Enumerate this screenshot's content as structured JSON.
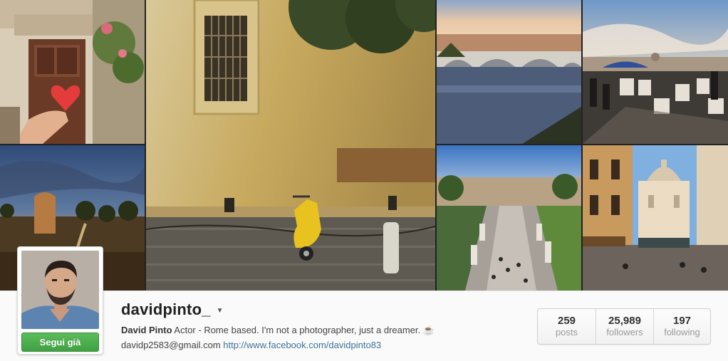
{
  "profile": {
    "username": "davidpinto_",
    "full_name": "David Pinto",
    "bio": "Actor - Rome based. I'm not a photographer, just a dreamer. ☕",
    "email": "davidp2583@gmail.com",
    "website": "http://www.facebook.com/davidpinto83",
    "follow_button_label": "Segui già"
  },
  "stats": [
    {
      "value": "259",
      "label": "posts"
    },
    {
      "value": "25,989",
      "label": "followers"
    },
    {
      "value": "197",
      "label": "following"
    }
  ],
  "icons": {
    "username_menu": "caret-down-icon"
  },
  "colors": {
    "follow_button": "#3fa143",
    "link": "#3f729b"
  }
}
